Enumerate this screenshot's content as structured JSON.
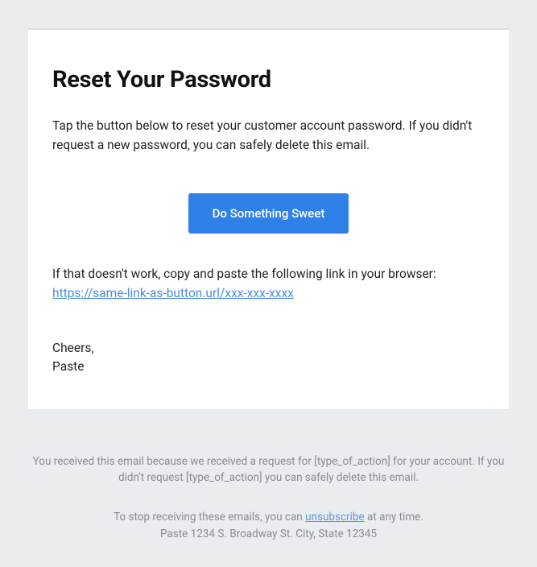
{
  "email": {
    "heading": "Reset Your Password",
    "body": "Tap the button below to reset your customer account password. If you didn't request a new password, you can safely delete this email.",
    "button_label": "Do Something Sweet",
    "fallback_prefix": "If that doesn't work, copy and paste the following link in your browser:",
    "fallback_link": "https://same-link-as-button.url/xxx-xxx-xxxx",
    "signoff_greeting": "Cheers,",
    "signoff_name": "Paste"
  },
  "footer": {
    "reason": "You received this email because we received a request for [type_of_action] for your account. If you didn't request [type_of_action] you can safely delete this email.",
    "unsubscribe_prefix": "To stop receiving these emails, you can ",
    "unsubscribe_link_text": "unsubscribe",
    "unsubscribe_suffix": " at any time.",
    "address": "Paste 1234 S. Broadway St. City, State 12345"
  }
}
